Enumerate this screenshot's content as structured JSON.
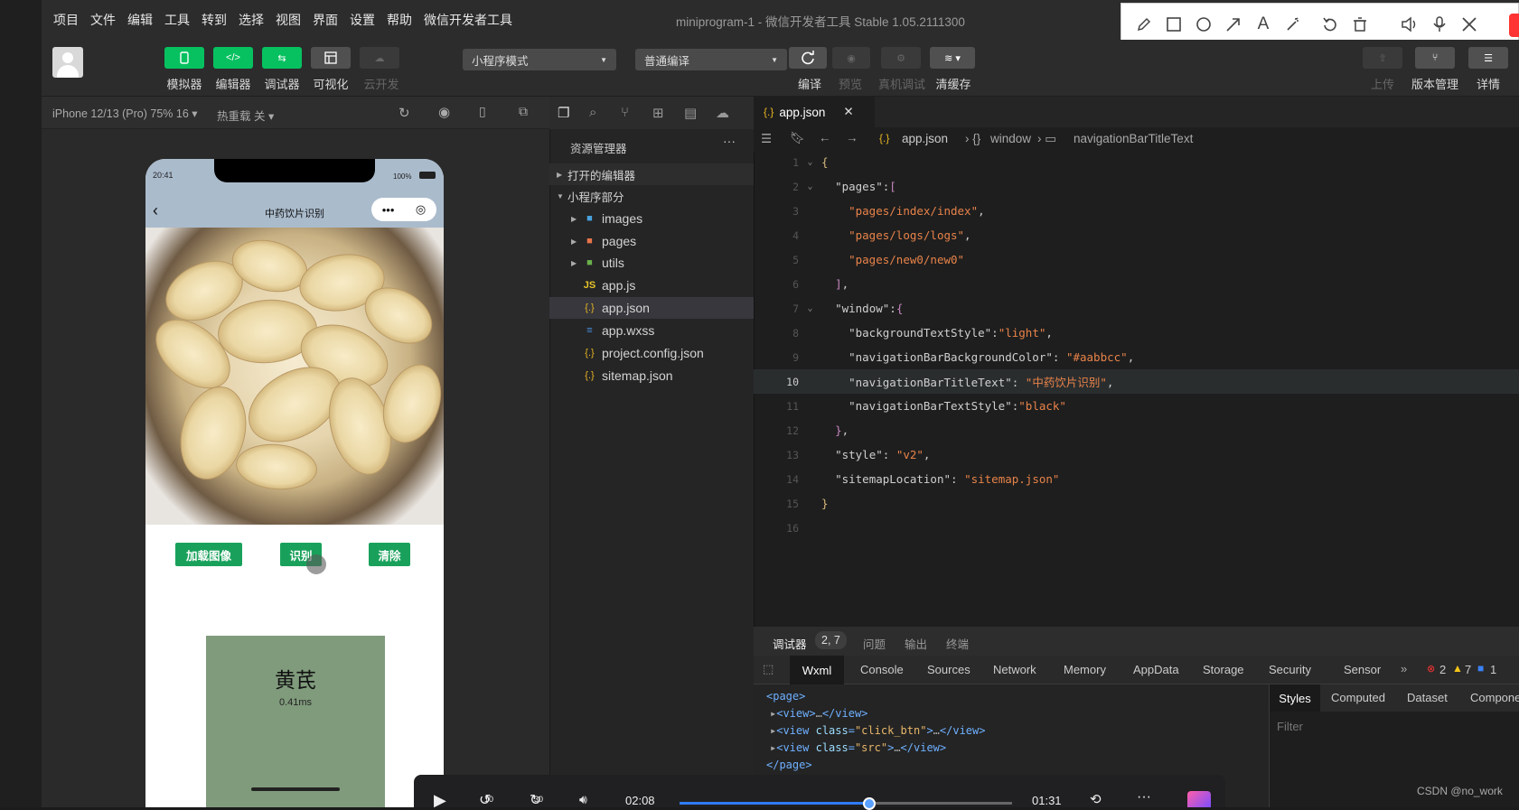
{
  "menu": [
    "项目",
    "文件",
    "编辑",
    "工具",
    "转到",
    "选择",
    "视图",
    "界面",
    "设置",
    "帮助",
    "微信开发者工具"
  ],
  "window_title": "miniprogram-1 - 微信开发者工具 Stable 1.05.2111300",
  "toolbar": {
    "left_buttons": [
      "模拟器",
      "编辑器",
      "调试器",
      "可视化",
      "云开发"
    ],
    "mode_select": "小程序模式",
    "compile_select": "普通编译",
    "mid_labels": [
      "编译",
      "预览",
      "真机调试",
      "清缓存"
    ],
    "right_labels": [
      "上传",
      "版本管理",
      "详情"
    ]
  },
  "simulator": {
    "device": "iPhone 12/13 (Pro) 75% 16",
    "hot_reload": "热重载 关",
    "time": "20:41",
    "battery": "100%",
    "nav_title": "中药饮片识别",
    "btn_load": "加载图像",
    "btn_recognize": "识别",
    "btn_clear": "清除",
    "result_name": "黄芪",
    "result_time": "0.41ms"
  },
  "explorer": {
    "title": "资源管理器",
    "open_editors": "打开的编辑器",
    "project": "小程序部分",
    "items": [
      "images",
      "pages",
      "utils",
      "app.js",
      "app.json",
      "app.wxss",
      "project.config.json",
      "sitemap.json"
    ]
  },
  "editor": {
    "tab": "app.json",
    "crumbs": [
      "app.json",
      "window",
      "navigationBarTitleText"
    ],
    "lines": [
      "1",
      "2",
      "3",
      "4",
      "5",
      "6",
      "7",
      "8",
      "9",
      "10",
      "11",
      "12",
      "13",
      "14",
      "15",
      "16"
    ]
  },
  "debugger": {
    "tabs": [
      "调试器",
      "2, 7",
      "问题",
      "输出",
      "终端"
    ],
    "devtabs": [
      "Wxml",
      "Console",
      "Sources",
      "Network",
      "Memory",
      "AppData",
      "Storage",
      "Security",
      "Sensor"
    ],
    "errors": "2",
    "warnings": "7",
    "infos": "1",
    "style_tabs": [
      "Styles",
      "Computed",
      "Dataset",
      "Compone"
    ],
    "filter_placeholder": "Filter"
  },
  "video": {
    "elapsed": "02:08",
    "remaining": "01:31",
    "progress": 0.57,
    "skip_back": "10",
    "skip_fwd": "30"
  },
  "watermark": "CSDN @no_work"
}
